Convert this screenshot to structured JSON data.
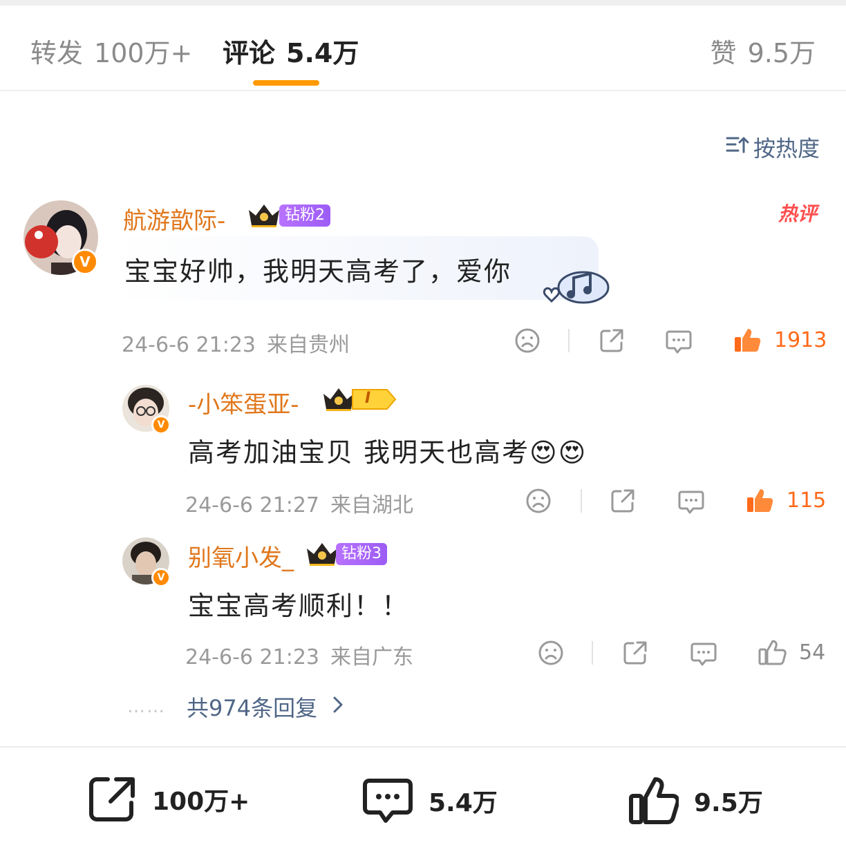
{
  "tabs": {
    "repost": {
      "label": "转发",
      "count": "100万+"
    },
    "comment": {
      "label": "评论",
      "count": "5.4万"
    },
    "like": {
      "label": "赞",
      "count": "9.5万"
    }
  },
  "sort": {
    "label": "按热度"
  },
  "comments": [
    {
      "username": "航游歆际-",
      "fan_badge": "钻粉2",
      "tag": "热评",
      "text": "宝宝好帅，我明天高考了，爱你",
      "time": "24-6-6 21:23",
      "location": "来自贵州",
      "likes": "1913"
    },
    {
      "username": "-小笨蛋亚-",
      "level_badge": "I",
      "text": "高考加油宝贝 我明天也高考😍😍",
      "time": "24-6-6 21:27",
      "location": "来自湖北",
      "likes": "115"
    },
    {
      "username": "别氧小发_",
      "fan_badge": "钻粉3",
      "text": "宝宝高考顺利！！",
      "time": "24-6-6 21:23",
      "location": "来自广东",
      "likes": "54"
    }
  ],
  "more_replies": {
    "dots": "……",
    "label": "共974条回复"
  },
  "bottom_bar": {
    "repost": "100万+",
    "comment": "5.4万",
    "like": "9.5万"
  },
  "colors": {
    "accent": "#ff9a00",
    "username": "#e0771c",
    "link": "#4f6686",
    "hot_like": "#ff6a1a",
    "verified": "#ff8a00"
  }
}
